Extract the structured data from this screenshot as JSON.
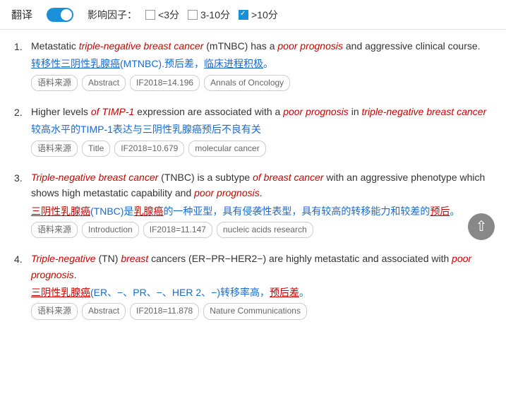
{
  "toolbar": {
    "translate_label": "翻译",
    "toggle_on": true,
    "filter_label": "影响因子：",
    "filters": [
      {
        "id": "lt3",
        "label": "<3分",
        "checked": false
      },
      {
        "id": "3to10",
        "label": "3-10分",
        "checked": false
      },
      {
        "id": "gt10",
        "label": ">10分",
        "checked": true
      }
    ]
  },
  "results": [
    {
      "number": "1.",
      "en_parts": [
        {
          "text": "Metastatic ",
          "style": "normal"
        },
        {
          "text": "triple-negative breast cancer",
          "style": "italic-red"
        },
        {
          "text": " (mTNBC) has a ",
          "style": "normal"
        },
        {
          "text": "poor prognosis",
          "style": "italic-red"
        },
        {
          "text": " and aggressive clinical course.",
          "style": "normal"
        }
      ],
      "zh_parts": [
        {
          "text": "转移性三阴性乳腺癌",
          "style": "blue-underline"
        },
        {
          "text": "(MTNBC)",
          "style": "blue"
        },
        {
          "text": ".预后差，",
          "style": "blue"
        },
        {
          "text": "临床进程积极",
          "style": "blue-underline"
        },
        {
          "text": "。",
          "style": "blue"
        }
      ],
      "tags": [
        "语料来源",
        "Abstract",
        "IF2018=14.196",
        "Annals of Oncology"
      ]
    },
    {
      "number": "2.",
      "en_parts": [
        {
          "text": "Higher levels ",
          "style": "normal"
        },
        {
          "text": "of TIMP-1",
          "style": "italic-red"
        },
        {
          "text": " expression are associated with a ",
          "style": "normal"
        },
        {
          "text": "poor prognosis",
          "style": "italic-red"
        },
        {
          "text": " in ",
          "style": "normal"
        },
        {
          "text": "triple-negative breast cancer",
          "style": "italic-red"
        }
      ],
      "zh_parts": [
        {
          "text": "较高水平的TIMP-1表达与三阴性乳腺癌预后不良有关",
          "style": "blue"
        }
      ],
      "tags": [
        "语料来源",
        "Title",
        "IF2018=10.679",
        "molecular cancer"
      ]
    },
    {
      "number": "3.",
      "en_parts": [
        {
          "text": "Triple-negative breast cancer",
          "style": "italic-red"
        },
        {
          "text": " (TNBC) is a subtype ",
          "style": "normal"
        },
        {
          "text": "of breast cancer",
          "style": "italic-red"
        },
        {
          "text": " with an aggressive phenotype which shows high metastatic capability and ",
          "style": "normal"
        },
        {
          "text": "poor prognosis",
          "style": "italic-red"
        },
        {
          "text": ".",
          "style": "normal"
        }
      ],
      "zh_parts": [
        {
          "text": "三阴性乳腺癌",
          "style": "red-underline"
        },
        {
          "text": "(TNBC)是",
          "style": "blue"
        },
        {
          "text": "乳腺癌",
          "style": "red-underline"
        },
        {
          "text": "的一种亚型，具有侵袭性表型，具有较高的转移能力和较差的",
          "style": "blue"
        },
        {
          "text": "预后",
          "style": "red-underline"
        },
        {
          "text": "。",
          "style": "blue"
        }
      ],
      "tags": [
        "语料来源",
        "Introduction",
        "IF2018=11.147",
        "nucleic acids research"
      ]
    },
    {
      "number": "4.",
      "en_parts": [
        {
          "text": "Triple-negative",
          "style": "italic-red"
        },
        {
          "text": " (TN) ",
          "style": "normal"
        },
        {
          "text": "breast",
          "style": "italic-red"
        },
        {
          "text": " cancers (ER−PR−HER2−) are highly metastatic and associated with ",
          "style": "normal"
        },
        {
          "text": "poor prognosis",
          "style": "italic-red"
        },
        {
          "text": ".",
          "style": "normal"
        }
      ],
      "zh_parts": [
        {
          "text": "三阴性乳腺癌",
          "style": "red-underline"
        },
        {
          "text": "(ER、−、PR、−、HER 2、−)转移率高，",
          "style": "blue"
        },
        {
          "text": "预后差",
          "style": "red-underline"
        },
        {
          "text": "。",
          "style": "blue"
        }
      ],
      "tags": [
        "语料来源",
        "Abstract",
        "IF2018=11.878",
        "Nature Communications"
      ]
    }
  ],
  "scroll_top_label": "↑"
}
